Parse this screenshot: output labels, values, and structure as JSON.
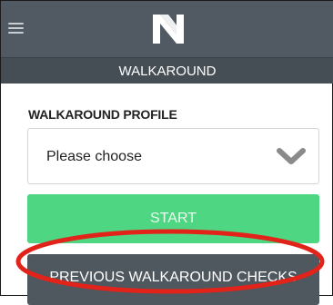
{
  "header": {
    "logo_icon": "brand-n-logo-icon",
    "menu_icon": "hamburger-menu-icon",
    "section_title": "WALKAROUND"
  },
  "form": {
    "profile_label": "WALKAROUND PROFILE",
    "profile_select": {
      "value": "Please choose",
      "icon": "chevron-down-icon"
    },
    "start_label": "START",
    "previous_checks_label": "PREVIOUS WALKAROUND CHECKS"
  },
  "annotation": {
    "highlight_color": "#e2231a"
  },
  "colors": {
    "header_bg": "#515a63",
    "subheader_bg": "#454d55",
    "start_button": "#4ed682",
    "previous_button": "#4f575f"
  }
}
